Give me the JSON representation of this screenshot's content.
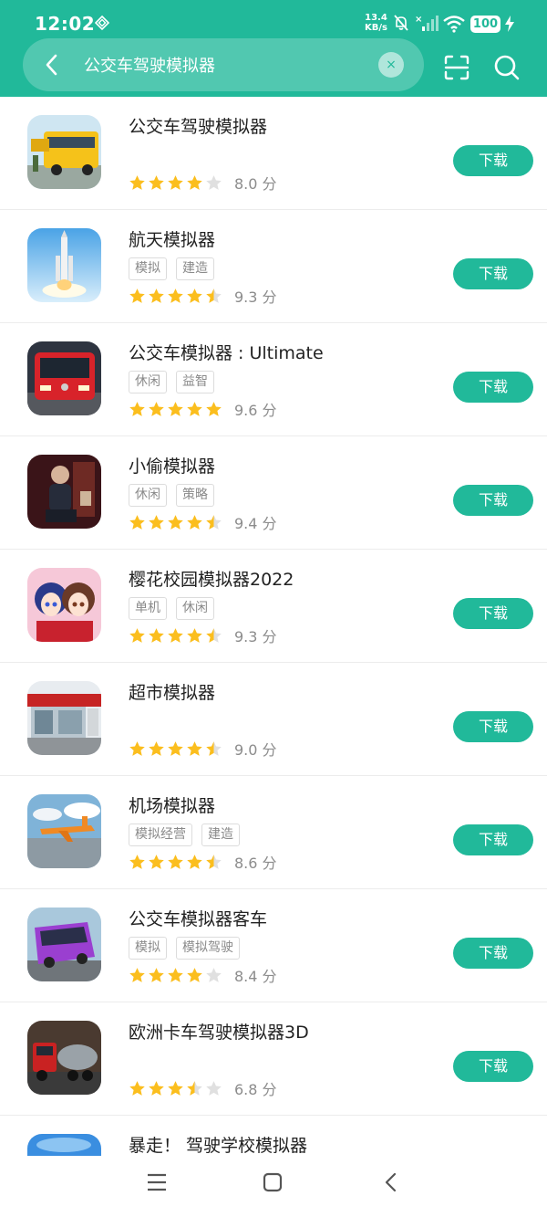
{
  "status_bar": {
    "time": "12:02",
    "net_speed_value": "13.4",
    "net_speed_unit": "KB/s",
    "battery": "100"
  },
  "search": {
    "query": "公交车驾驶模拟器",
    "clear_symbol": "×"
  },
  "colors": {
    "brand": "#21b99a",
    "star": "#fbbe1e",
    "star_empty": "#e0e0e0"
  },
  "results": [
    {
      "name": "公交车驾驶模拟器",
      "tags": [],
      "stars": 4,
      "score": "8.0 分",
      "action": "下载",
      "icon": "bus-driver-app-icon"
    },
    {
      "name": "航天模拟器",
      "tags": [
        "模拟",
        "建造"
      ],
      "stars": 4.5,
      "score": "9.3 分",
      "action": "下载",
      "icon": "rocket-app-icon"
    },
    {
      "name": "公交车模拟器 : Ultimate",
      "tags": [
        "休闲",
        "益智"
      ],
      "stars": 5,
      "score": "9.6 分",
      "action": "下载",
      "icon": "red-bus-app-icon"
    },
    {
      "name": "小偷模拟器",
      "tags": [
        "休闲",
        "策略"
      ],
      "stars": 4.5,
      "score": "9.4 分",
      "action": "下载",
      "icon": "thief-app-icon"
    },
    {
      "name": "樱花校园模拟器2022",
      "tags": [
        "单机",
        "休闲"
      ],
      "stars": 4.5,
      "score": "9.3 分",
      "action": "下载",
      "icon": "anime-girls-app-icon"
    },
    {
      "name": "超市模拟器",
      "tags": [],
      "stars": 4.5,
      "score": "9.0 分",
      "action": "下载",
      "icon": "supermarket-app-icon"
    },
    {
      "name": "机场模拟器",
      "tags": [
        "模拟经营",
        "建造"
      ],
      "stars": 4.5,
      "score": "8.6 分",
      "action": "下载",
      "icon": "airplane-app-icon"
    },
    {
      "name": "公交车模拟器客车",
      "tags": [
        "模拟",
        "模拟驾驶"
      ],
      "stars": 4,
      "score": "8.4 分",
      "action": "下载",
      "icon": "purple-bus-app-icon"
    },
    {
      "name": "欧洲卡车驾驶模拟器3D",
      "tags": [],
      "stars": 3.5,
      "score": "6.8 分",
      "action": "下载",
      "icon": "truck-app-icon"
    },
    {
      "name": "暴走！ 驾驶学校模拟器",
      "tags": [],
      "stars": 0,
      "score": "",
      "action": "",
      "icon": "driving-school-app-icon"
    }
  ],
  "nav_icons": [
    "menu-icon",
    "home-icon",
    "back-icon"
  ]
}
